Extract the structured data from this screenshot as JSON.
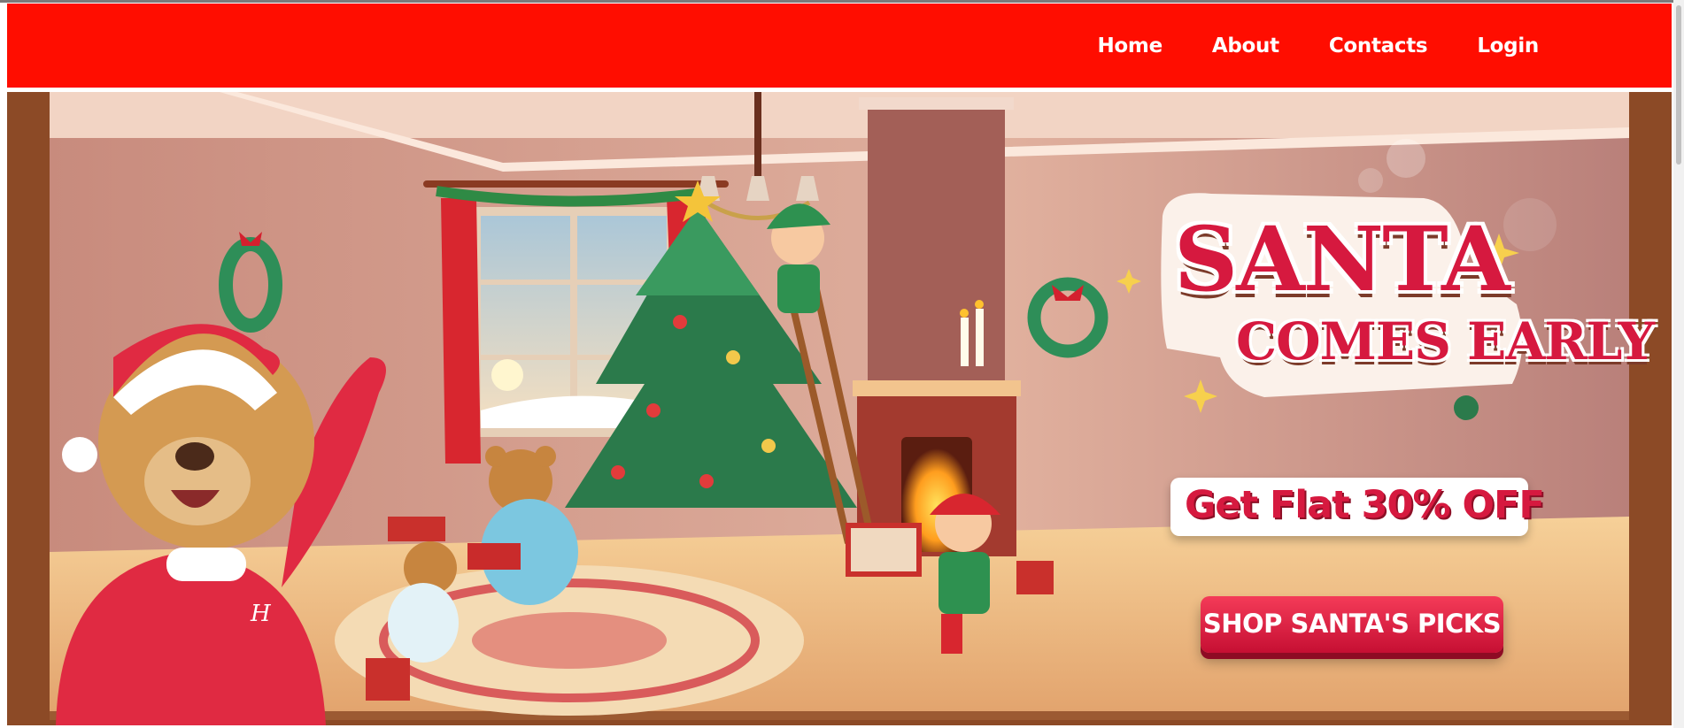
{
  "nav": {
    "links": [
      {
        "label": "Home"
      },
      {
        "label": "About"
      },
      {
        "label": "Contacts"
      },
      {
        "label": "Login"
      }
    ]
  },
  "banner": {
    "title_line1": "SANTA",
    "title_line2": "COMES EARLY",
    "offer": "Get Flat 30% OFF",
    "cta": "SHOP SANTA'S PICKS",
    "bear_logo": "H",
    "colors": {
      "navbar": "#ff0d00",
      "brand_red": "#d6193f",
      "wall": "#d7a091",
      "floor": "#f3c98f"
    }
  }
}
